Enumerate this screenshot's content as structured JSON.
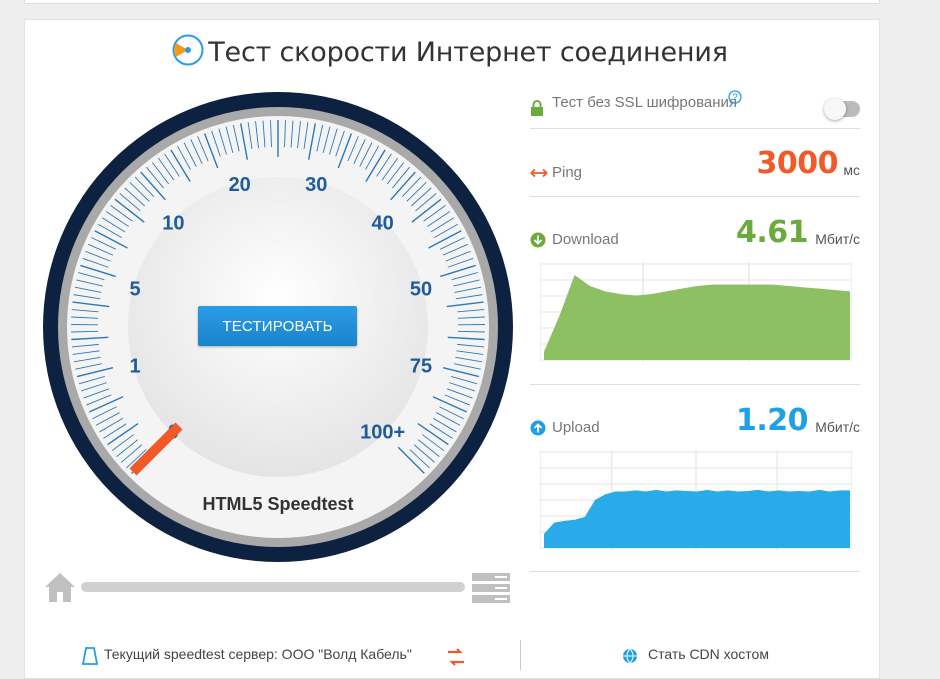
{
  "page": {
    "title": "Тест скорости Интернет соединения"
  },
  "gauge": {
    "labels": [
      {
        "text": "0",
        "value": 0
      },
      {
        "text": "1",
        "value": 1
      },
      {
        "text": "5",
        "value": 5
      },
      {
        "text": "10",
        "value": 10
      },
      {
        "text": "20",
        "value": 20
      },
      {
        "text": "30",
        "value": 30
      },
      {
        "text": "40",
        "value": 40
      },
      {
        "text": "50",
        "value": 50
      },
      {
        "text": "75",
        "value": 75
      },
      {
        "text": "100+",
        "value": 100
      }
    ],
    "brand": "HTML5 Speedtest",
    "needle_value": 0,
    "button_label": "ТЕСТИРОВАТЬ"
  },
  "ssl": {
    "label": "Тест без SSL шифрования",
    "enabled": false
  },
  "ping": {
    "label": "Ping",
    "value": "3000",
    "unit": "мс",
    "color": "#f05a28"
  },
  "download": {
    "label": "Download",
    "value": "4.61",
    "unit": "Мбит/с",
    "color": "#6aab3c"
  },
  "upload": {
    "label": "Upload",
    "value": "1.20",
    "unit": "Мбит/с",
    "color": "#1ea0e6"
  },
  "progress": {
    "fraction": 0.0
  },
  "footer": {
    "server_text": "Текущий speedtest сервер: ООО \"Волд Кабель\"",
    "cdn_text": "Стать CDN хостом"
  },
  "chart_data": [
    {
      "type": "area",
      "name": "download-history",
      "x": [
        0,
        1,
        2,
        3,
        4,
        5,
        6,
        7,
        8,
        9,
        10,
        11,
        12,
        13,
        14,
        15,
        16,
        17,
        18,
        19,
        20
      ],
      "values": [
        0.6,
        3.2,
        6.2,
        5.4,
        5.0,
        4.8,
        4.7,
        4.8,
        5.0,
        5.2,
        5.4,
        5.5,
        5.5,
        5.5,
        5.5,
        5.5,
        5.4,
        5.3,
        5.2,
        5.1,
        5.0
      ],
      "ylim": [
        0,
        7
      ],
      "color": "#8cc063"
    },
    {
      "type": "area",
      "name": "upload-history",
      "x": [
        0,
        1,
        2,
        3,
        4,
        5,
        6,
        7,
        8,
        9,
        10,
        11,
        12,
        13,
        14,
        15,
        16,
        17,
        18,
        19,
        20,
        21,
        22,
        23,
        24,
        25,
        26,
        27,
        28,
        29,
        30
      ],
      "values": [
        0.25,
        0.45,
        0.48,
        0.5,
        0.55,
        0.85,
        0.95,
        1.0,
        1.0,
        1.02,
        1.0,
        1.03,
        1.0,
        1.02,
        1.01,
        1.0,
        1.03,
        1.0,
        1.02,
        1.0,
        1.01,
        1.03,
        1.0,
        1.02,
        1.0,
        1.01,
        1.0,
        1.03,
        1.0,
        1.02,
        1.02
      ],
      "ylim": [
        0,
        1.7
      ],
      "color": "#29abe9"
    }
  ]
}
